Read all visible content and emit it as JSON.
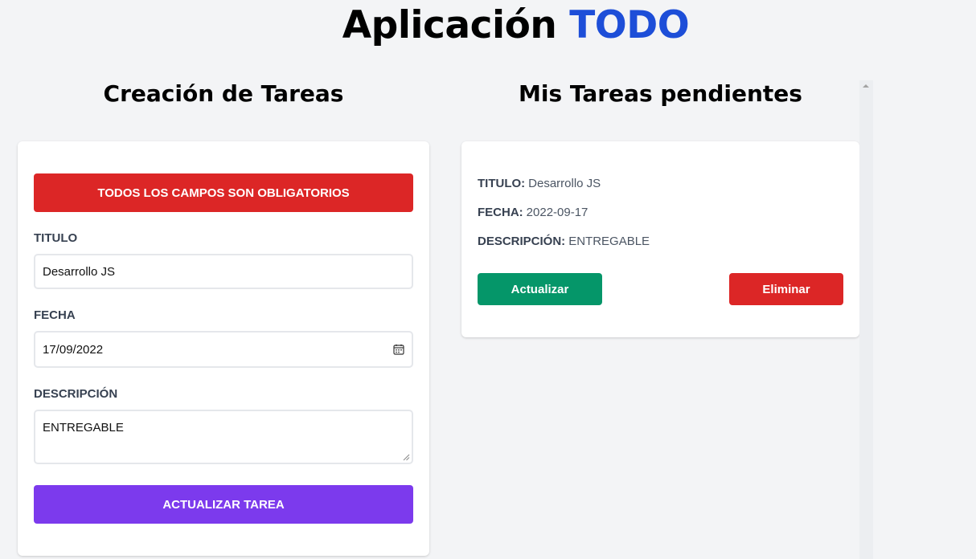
{
  "app": {
    "title_main": "Aplicación",
    "title_accent": "TODO"
  },
  "form": {
    "heading": "Creación de Tareas",
    "alert": "TODOS LOS CAMPOS SON OBLIGATORIOS",
    "title_label": "TITULO",
    "title_value": "Desarrollo JS",
    "date_label": "FECHA",
    "date_value": "17/09/2022",
    "desc_label": "DESCRIPCIÓN",
    "desc_value": "ENTREGABLE",
    "submit_label": "ACTUALIZAR TAREA"
  },
  "tasks": {
    "heading": "Mis Tareas pendientes",
    "items": [
      {
        "title_key": "TITULO:",
        "title": "Desarrollo JS",
        "date_key": "FECHA:",
        "date": "2022-09-17",
        "desc_key": "DESCRIPCIÓN:",
        "desc": "ENTREGABLE",
        "update_label": "Actualizar",
        "delete_label": "Eliminar"
      }
    ]
  },
  "colors": {
    "accent": "#1d4ed8",
    "alert": "#dc2626",
    "submit": "#7c3aed",
    "update": "#059669",
    "delete": "#dc2626",
    "background": "#f3f4f6"
  },
  "icons": {
    "date_picker": "calendar-icon",
    "scroll_up": "chevron-up-icon",
    "textarea_resize": "resize-grip-icon"
  }
}
